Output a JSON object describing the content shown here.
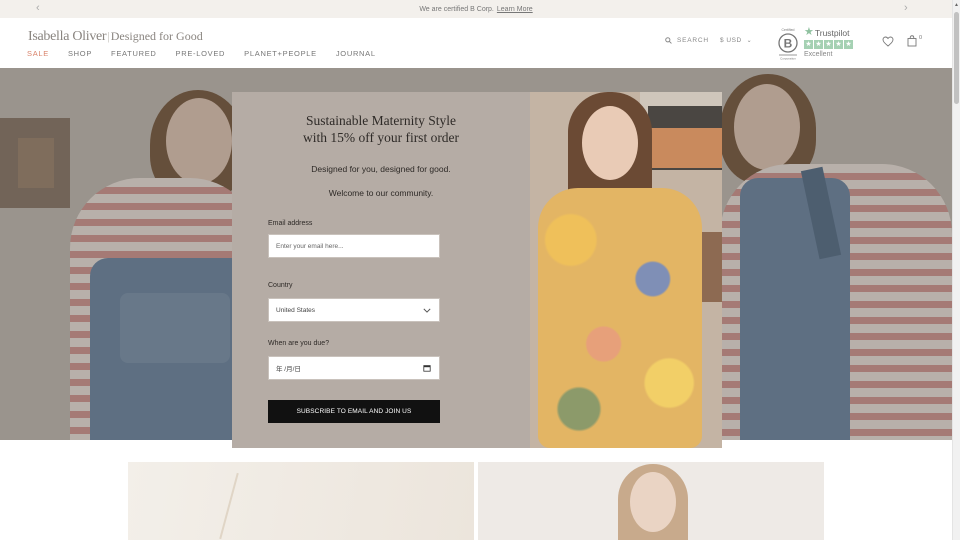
{
  "announcement": {
    "text": "We are certified B Corp.",
    "link": "Learn More",
    "prev_arrow": "‹",
    "next_arrow": "›"
  },
  "header": {
    "logo_brand": "Isabella Oliver",
    "logo_separator": "|",
    "logo_tagline": "Designed for Good",
    "nav": [
      {
        "label": "SALE"
      },
      {
        "label": "SHOP"
      },
      {
        "label": "FEATURED"
      },
      {
        "label": "PRE-LOVED"
      },
      {
        "label": "PLANET+PEOPLE"
      },
      {
        "label": "JOURNAL"
      }
    ],
    "search_label": "SEARCH",
    "currency": "$ USD",
    "bcorp": {
      "top_text": "Certified",
      "letter": "B",
      "bottom_text": "Corporation"
    },
    "trustpilot": {
      "name": "Trustpilot",
      "rating": "Excellent"
    },
    "cart_count": "0"
  },
  "modal": {
    "title_line1": "Sustainable Maternity Style",
    "title_line2": "with 15% off your first order",
    "subtitle1": "Designed for you, designed for good.",
    "subtitle2": "Welcome to our community.",
    "email_label": "Email address",
    "email_placeholder": "Enter your email here...",
    "country_label": "Country",
    "country_value": "United States",
    "due_label": "When are you due?",
    "due_placeholder": "年 /月/日",
    "subscribe_button": "SUBSCRIBE TO EMAIL AND JOIN US"
  },
  "colors": {
    "sale": "#d9826a",
    "button": "#111111",
    "modal_bg": "#b5aca5",
    "trustpilot_green": "#a5d1b3"
  },
  "icons": [
    "chevron-left-icon",
    "chevron-right-icon",
    "search-icon",
    "chevron-down-icon",
    "heart-icon",
    "bag-icon",
    "calendar-icon"
  ]
}
